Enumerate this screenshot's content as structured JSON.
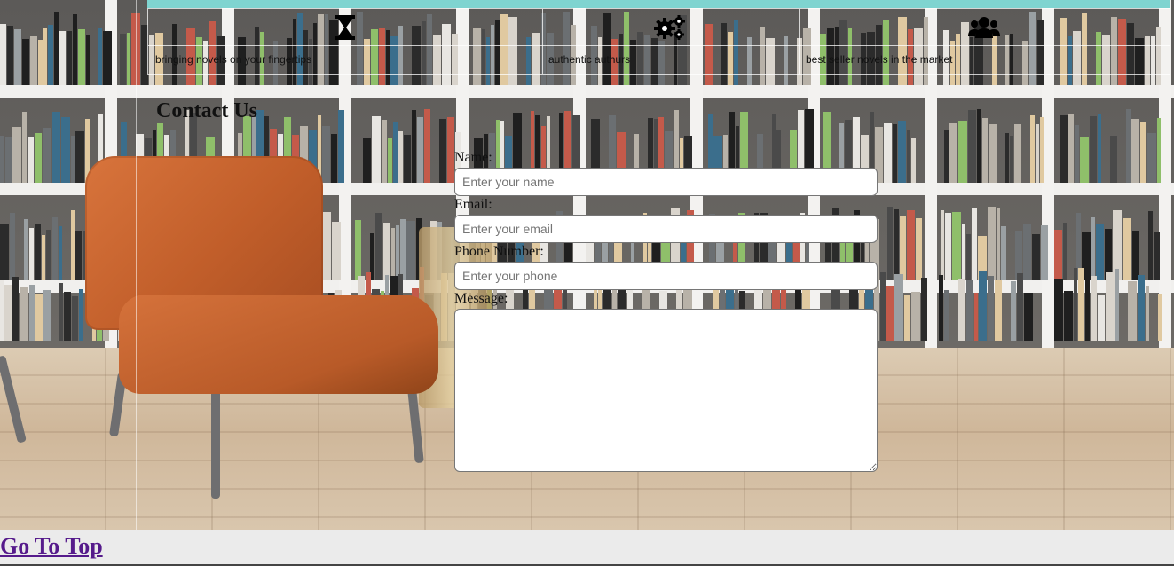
{
  "features": [
    {
      "icon": "hourglass-icon",
      "text": "bringing novels on your fingertips"
    },
    {
      "icon": "gears-icon",
      "text": "authentic authurs"
    },
    {
      "icon": "users-icon",
      "text": "best seller novels in the market"
    }
  ],
  "contact": {
    "title": "Contact Us",
    "name_label": "Name:",
    "name_placeholder": "Enter your name",
    "email_label": "Email:",
    "email_placeholder": "Enter your email",
    "phone_label": "Phone Number:",
    "phone_placeholder": "Enter your phone",
    "message_label": "Message:"
  },
  "footer": {
    "go_top_label": "Go To Top"
  },
  "colors": {
    "top_bar": "#7fd4d0",
    "link": "#551a8b",
    "footer_bg": "#ebebeb"
  }
}
